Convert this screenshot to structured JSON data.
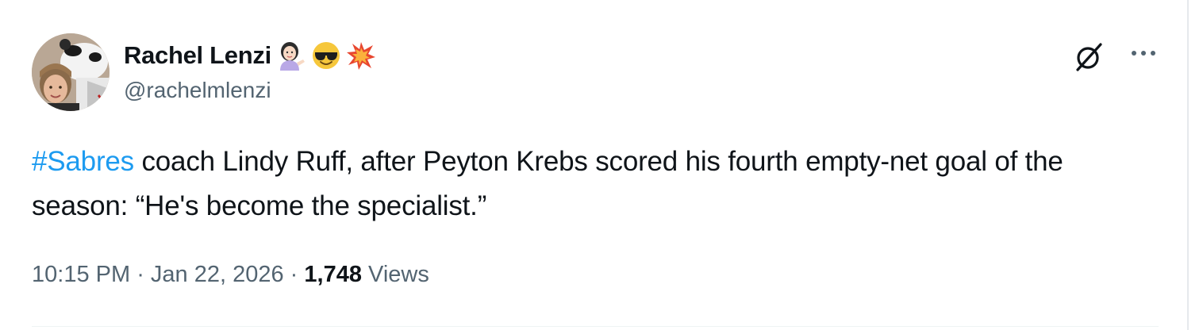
{
  "author": {
    "display_name": "Rachel Lenzi",
    "handle": "@rachelmlenzi",
    "emojis": [
      "woman-tipping-hand-emoji",
      "smiling-face-with-sunglasses-emoji",
      "collision-emoji"
    ]
  },
  "tweet": {
    "hashtag": "#Sabres",
    "text_after_hashtag": " coach Lindy Ruff, after Peyton Krebs scored his fourth empty-net goal of the season: “He's become the specialist.”"
  },
  "meta": {
    "time": "10:15 PM",
    "separator": " · ",
    "date": "Jan 22, 2026",
    "views_count": "1,748",
    "views_label": " Views"
  },
  "icons": {
    "top_right": [
      "grok-icon",
      "more-icon"
    ]
  },
  "colors": {
    "text_primary": "#0f1419",
    "text_secondary": "#536471",
    "link": "#1d9bf0",
    "border": "#e6e9ec"
  }
}
